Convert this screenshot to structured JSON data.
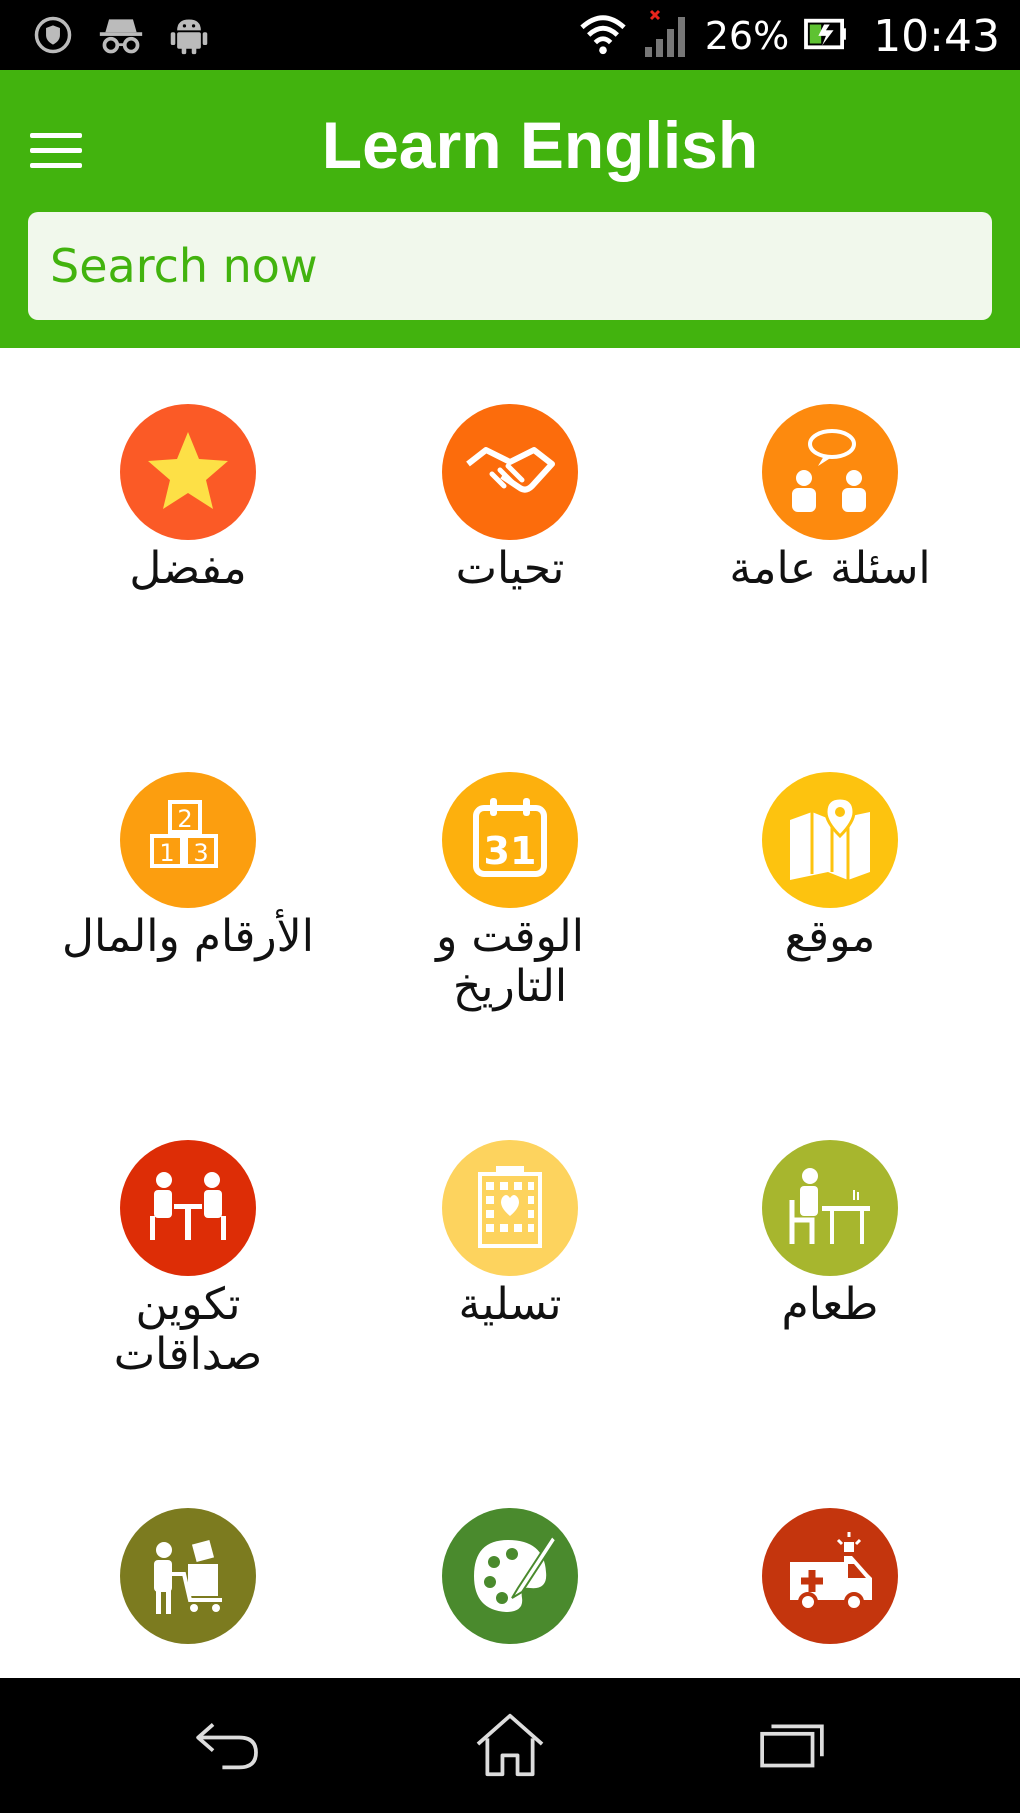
{
  "status_bar": {
    "battery_percent": "26%",
    "time": "10:43",
    "icons": [
      "shield-icon",
      "incognito-icon",
      "android-icon",
      "wifi-icon",
      "signal-icon",
      "battery-icon"
    ]
  },
  "app_bar": {
    "title": "Learn English",
    "search_placeholder": "Search now"
  },
  "categories": [
    {
      "label": "مفضل",
      "icon": "star-icon",
      "color": "#fb5a26"
    },
    {
      "label": "تحيات",
      "icon": "handshake-icon",
      "color": "#fc6c0c"
    },
    {
      "label": "اسئلة عامة",
      "icon": "conversation-icon",
      "color": "#fd8a0e"
    },
    {
      "label": "الأرقام والمال",
      "icon": "number-blocks-icon",
      "color": "#fc9e0f"
    },
    {
      "label": "الوقت و التاريخ",
      "icon": "calendar-icon",
      "color": "#fdb00d",
      "calendar_day": "31"
    },
    {
      "label": "موقع",
      "icon": "map-pin-icon",
      "color": "#fdc30f"
    },
    {
      "label": "تكوين صداقات",
      "icon": "friends-table-icon",
      "color": "#dd2d06"
    },
    {
      "label": "تسلية",
      "icon": "hotel-icon",
      "color": "#fdd35e"
    },
    {
      "label": "طعام",
      "icon": "dining-icon",
      "color": "#a7b62e"
    },
    {
      "label": "",
      "icon": "shopping-cart-icon",
      "color": "#7c7b1f"
    },
    {
      "label": "",
      "icon": "palette-icon",
      "color": "#4a8a2d"
    },
    {
      "label": "",
      "icon": "ambulance-icon",
      "color": "#c4350d"
    }
  ],
  "nav_bar": {
    "icons": [
      "back-icon",
      "home-icon",
      "recents-icon"
    ]
  },
  "colors": {
    "app_bar": "#42b30e",
    "search_bg": "#f1f8ec",
    "search_text": "#42b30e"
  }
}
